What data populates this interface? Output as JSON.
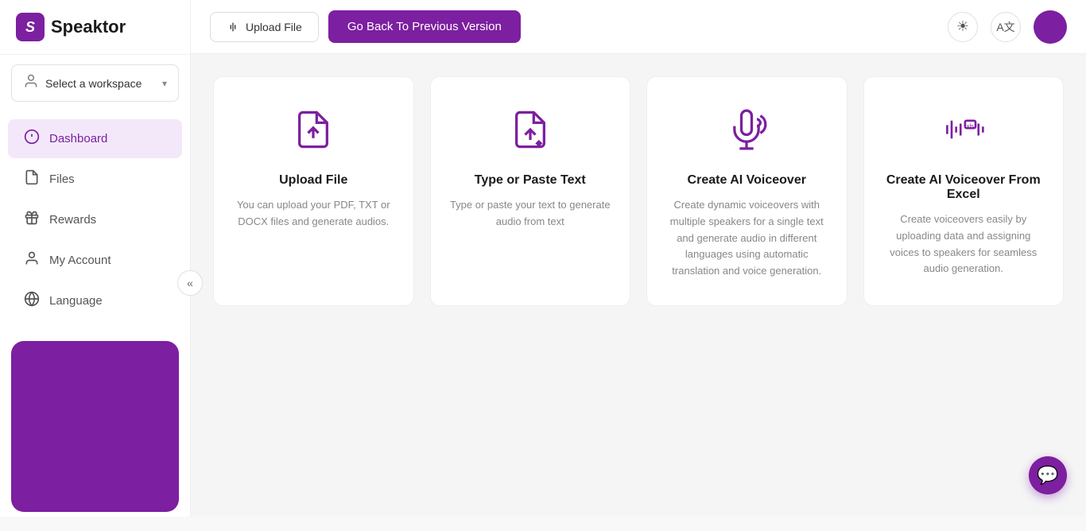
{
  "app": {
    "name": "Speaktor",
    "logo_letter": "S"
  },
  "sidebar": {
    "workspace_label": "Select a workspace",
    "nav_items": [
      {
        "id": "dashboard",
        "label": "Dashboard",
        "active": true
      },
      {
        "id": "files",
        "label": "Files",
        "active": false
      },
      {
        "id": "rewards",
        "label": "Rewards",
        "active": false
      },
      {
        "id": "my-account",
        "label": "My Account",
        "active": false
      },
      {
        "id": "language",
        "label": "Language",
        "active": false
      }
    ],
    "collapse_label": "«"
  },
  "topbar": {
    "upload_btn_label": "Upload File",
    "go_back_btn_label": "Go Back To Previous Version"
  },
  "cards": [
    {
      "id": "upload-file",
      "title": "Upload File",
      "description": "You can upload your PDF, TXT or DOCX files and generate audios."
    },
    {
      "id": "type-paste-text",
      "title": "Type or Paste Text",
      "description": "Type or paste your text to generate audio from text"
    },
    {
      "id": "create-ai-voiceover",
      "title": "Create AI Voiceover",
      "description": "Create dynamic voiceovers with multiple speakers for a single text and generate audio in different languages using automatic translation and voice generation."
    },
    {
      "id": "create-ai-voiceover-excel",
      "title": "Create AI Voiceover From Excel",
      "description": "Create voiceovers easily by uploading data and assigning voices to speakers for seamless audio generation."
    }
  ],
  "colors": {
    "primary": "#7c1fa0",
    "primary_light": "#f3e8fa"
  }
}
